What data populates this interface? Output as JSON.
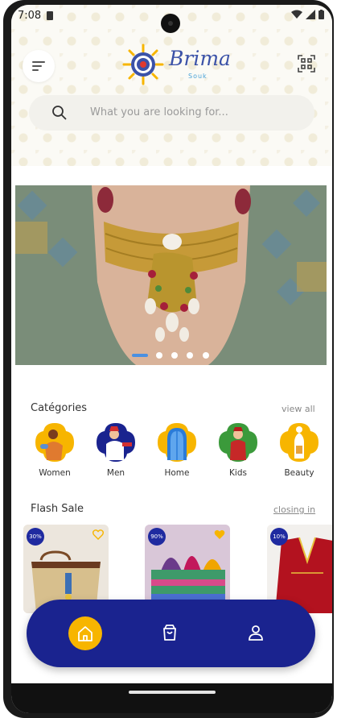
{
  "status_bar": {
    "time": "7:08"
  },
  "header": {
    "logo_text": "Brima",
    "logo_sub": "Souk",
    "menu_icon": "menu-icon",
    "qr_icon": "qr-scan-icon"
  },
  "search": {
    "placeholder": "What you are looking for..."
  },
  "banner": {
    "slides": 5,
    "active_slide": 1
  },
  "categories": {
    "title": "Catégories",
    "view_all": "view all",
    "items": [
      {
        "label": "Women"
      },
      {
        "label": "Men"
      },
      {
        "label": "Home"
      },
      {
        "label": "Kids"
      },
      {
        "label": "Beauty"
      }
    ]
  },
  "flash_sale": {
    "title": "Flash Sale",
    "link": "closing in",
    "products": [
      {
        "discount": "30%",
        "favorite": false
      },
      {
        "discount": "90%",
        "favorite": true
      },
      {
        "discount": "10%",
        "favorite": false
      }
    ]
  },
  "bottom_nav": {
    "items": [
      "home-icon",
      "cart-icon",
      "profile-icon"
    ],
    "active": "home-icon"
  },
  "colors": {
    "brand_blue": "#1a238f",
    "accent_yellow": "#f7b500",
    "badge_blue": "#1f2aa0",
    "indicator_blue": "#4a90e2"
  }
}
